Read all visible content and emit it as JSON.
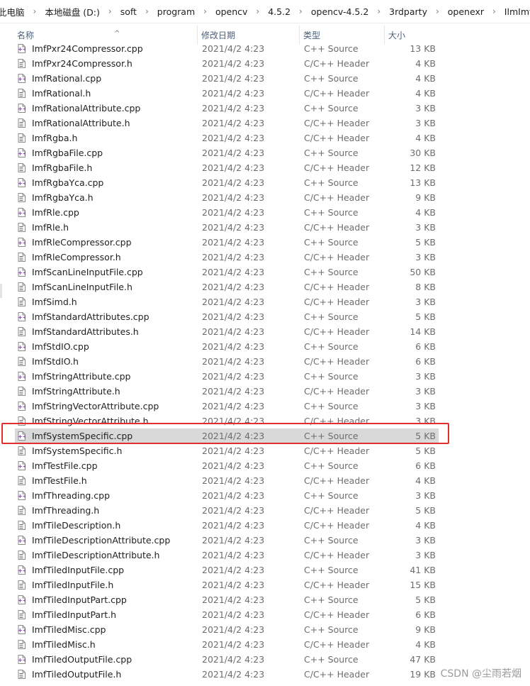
{
  "breadcrumb": [
    "此电脑",
    "本地磁盘 (D:)",
    "soft",
    "program",
    "opencv",
    "4.5.2",
    "opencv-4.5.2",
    "3rdparty",
    "openexr",
    "IlmImf"
  ],
  "columns": {
    "name": "名称",
    "date": "修改日期",
    "type": "类型",
    "size": "大小"
  },
  "files": [
    {
      "name": "ImfPxr24Compressor.cpp",
      "date": "2021/4/2 4:23",
      "type": "C++ Source",
      "size": "13 KB",
      "icon": "cpp-file-icon"
    },
    {
      "name": "ImfPxr24Compressor.h",
      "date": "2021/4/2 4:23",
      "type": "C/C++ Header",
      "size": "4 KB",
      "icon": "header-file-icon"
    },
    {
      "name": "ImfRational.cpp",
      "date": "2021/4/2 4:23",
      "type": "C++ Source",
      "size": "4 KB",
      "icon": "cpp-file-icon"
    },
    {
      "name": "ImfRational.h",
      "date": "2021/4/2 4:23",
      "type": "C/C++ Header",
      "size": "4 KB",
      "icon": "header-file-icon"
    },
    {
      "name": "ImfRationalAttribute.cpp",
      "date": "2021/4/2 4:23",
      "type": "C++ Source",
      "size": "3 KB",
      "icon": "cpp-file-icon"
    },
    {
      "name": "ImfRationalAttribute.h",
      "date": "2021/4/2 4:23",
      "type": "C/C++ Header",
      "size": "3 KB",
      "icon": "header-file-icon"
    },
    {
      "name": "ImfRgba.h",
      "date": "2021/4/2 4:23",
      "type": "C/C++ Header",
      "size": "4 KB",
      "icon": "header-file-icon"
    },
    {
      "name": "ImfRgbaFile.cpp",
      "date": "2021/4/2 4:23",
      "type": "C++ Source",
      "size": "30 KB",
      "icon": "cpp-file-icon"
    },
    {
      "name": "ImfRgbaFile.h",
      "date": "2021/4/2 4:23",
      "type": "C/C++ Header",
      "size": "12 KB",
      "icon": "header-file-icon"
    },
    {
      "name": "ImfRgbaYca.cpp",
      "date": "2021/4/2 4:23",
      "type": "C++ Source",
      "size": "13 KB",
      "icon": "cpp-file-icon"
    },
    {
      "name": "ImfRgbaYca.h",
      "date": "2021/4/2 4:23",
      "type": "C/C++ Header",
      "size": "9 KB",
      "icon": "header-file-icon"
    },
    {
      "name": "ImfRle.cpp",
      "date": "2021/4/2 4:23",
      "type": "C++ Source",
      "size": "4 KB",
      "icon": "cpp-file-icon"
    },
    {
      "name": "ImfRle.h",
      "date": "2021/4/2 4:23",
      "type": "C/C++ Header",
      "size": "3 KB",
      "icon": "header-file-icon"
    },
    {
      "name": "ImfRleCompressor.cpp",
      "date": "2021/4/2 4:23",
      "type": "C++ Source",
      "size": "5 KB",
      "icon": "cpp-file-icon"
    },
    {
      "name": "ImfRleCompressor.h",
      "date": "2021/4/2 4:23",
      "type": "C/C++ Header",
      "size": "3 KB",
      "icon": "header-file-icon"
    },
    {
      "name": "ImfScanLineInputFile.cpp",
      "date": "2021/4/2 4:23",
      "type": "C++ Source",
      "size": "50 KB",
      "icon": "cpp-file-icon"
    },
    {
      "name": "ImfScanLineInputFile.h",
      "date": "2021/4/2 4:23",
      "type": "C/C++ Header",
      "size": "8 KB",
      "icon": "header-file-icon"
    },
    {
      "name": "ImfSimd.h",
      "date": "2021/4/2 4:23",
      "type": "C/C++ Header",
      "size": "3 KB",
      "icon": "header-file-icon"
    },
    {
      "name": "ImfStandardAttributes.cpp",
      "date": "2021/4/2 4:23",
      "type": "C++ Source",
      "size": "5 KB",
      "icon": "cpp-file-icon"
    },
    {
      "name": "ImfStandardAttributes.h",
      "date": "2021/4/2 4:23",
      "type": "C/C++ Header",
      "size": "14 KB",
      "icon": "header-file-icon"
    },
    {
      "name": "ImfStdIO.cpp",
      "date": "2021/4/2 4:23",
      "type": "C++ Source",
      "size": "6 KB",
      "icon": "cpp-file-icon"
    },
    {
      "name": "ImfStdIO.h",
      "date": "2021/4/2 4:23",
      "type": "C/C++ Header",
      "size": "6 KB",
      "icon": "header-file-icon"
    },
    {
      "name": "ImfStringAttribute.cpp",
      "date": "2021/4/2 4:23",
      "type": "C++ Source",
      "size": "3 KB",
      "icon": "cpp-file-icon"
    },
    {
      "name": "ImfStringAttribute.h",
      "date": "2021/4/2 4:23",
      "type": "C/C++ Header",
      "size": "3 KB",
      "icon": "header-file-icon"
    },
    {
      "name": "ImfStringVectorAttribute.cpp",
      "date": "2021/4/2 4:23",
      "type": "C++ Source",
      "size": "3 KB",
      "icon": "cpp-file-icon"
    },
    {
      "name": "ImfStringVectorAttribute.h",
      "date": "2021/4/2 4:23",
      "type": "C/C++ Header",
      "size": "3 KB",
      "icon": "header-file-icon"
    },
    {
      "name": "ImfSystemSpecific.cpp",
      "date": "2021/4/2 4:23",
      "type": "C++ Source",
      "size": "5 KB",
      "icon": "cpp-file-icon",
      "selected": true
    },
    {
      "name": "ImfSystemSpecific.h",
      "date": "2021/4/2 4:23",
      "type": "C/C++ Header",
      "size": "5 KB",
      "icon": "header-file-icon"
    },
    {
      "name": "ImfTestFile.cpp",
      "date": "2021/4/2 4:23",
      "type": "C++ Source",
      "size": "6 KB",
      "icon": "cpp-file-icon"
    },
    {
      "name": "ImfTestFile.h",
      "date": "2021/4/2 4:23",
      "type": "C/C++ Header",
      "size": "4 KB",
      "icon": "header-file-icon"
    },
    {
      "name": "ImfThreading.cpp",
      "date": "2021/4/2 4:23",
      "type": "C++ Source",
      "size": "3 KB",
      "icon": "cpp-file-icon"
    },
    {
      "name": "ImfThreading.h",
      "date": "2021/4/2 4:23",
      "type": "C/C++ Header",
      "size": "5 KB",
      "icon": "header-file-icon"
    },
    {
      "name": "ImfTileDescription.h",
      "date": "2021/4/2 4:23",
      "type": "C/C++ Header",
      "size": "4 KB",
      "icon": "header-file-icon"
    },
    {
      "name": "ImfTileDescriptionAttribute.cpp",
      "date": "2021/4/2 4:23",
      "type": "C++ Source",
      "size": "3 KB",
      "icon": "cpp-file-icon"
    },
    {
      "name": "ImfTileDescriptionAttribute.h",
      "date": "2021/4/2 4:23",
      "type": "C/C++ Header",
      "size": "3 KB",
      "icon": "header-file-icon"
    },
    {
      "name": "ImfTiledInputFile.cpp",
      "date": "2021/4/2 4:23",
      "type": "C++ Source",
      "size": "41 KB",
      "icon": "cpp-file-icon"
    },
    {
      "name": "ImfTiledInputFile.h",
      "date": "2021/4/2 4:23",
      "type": "C/C++ Header",
      "size": "15 KB",
      "icon": "header-file-icon"
    },
    {
      "name": "ImfTiledInputPart.cpp",
      "date": "2021/4/2 4:23",
      "type": "C++ Source",
      "size": "5 KB",
      "icon": "cpp-file-icon"
    },
    {
      "name": "ImfTiledInputPart.h",
      "date": "2021/4/2 4:23",
      "type": "C/C++ Header",
      "size": "6 KB",
      "icon": "header-file-icon"
    },
    {
      "name": "ImfTiledMisc.cpp",
      "date": "2021/4/2 4:23",
      "type": "C++ Source",
      "size": "9 KB",
      "icon": "cpp-file-icon"
    },
    {
      "name": "ImfTiledMisc.h",
      "date": "2021/4/2 4:23",
      "type": "C/C++ Header",
      "size": "4 KB",
      "icon": "header-file-icon"
    },
    {
      "name": "ImfTiledOutputFile.cpp",
      "date": "2021/4/2 4:23",
      "type": "C++ Source",
      "size": "47 KB",
      "icon": "cpp-file-icon"
    },
    {
      "name": "ImfTiledOutputFile.h",
      "date": "2021/4/2 4:23",
      "type": "C/C++ Header",
      "size": "19 KB",
      "icon": "header-file-icon"
    }
  ],
  "watermark": "CSDN @尘雨若烟",
  "colors": {
    "selection": "#d9d9d9",
    "annotation_box": "#e0302d",
    "file_icon_accent": "#7b3fa0"
  }
}
